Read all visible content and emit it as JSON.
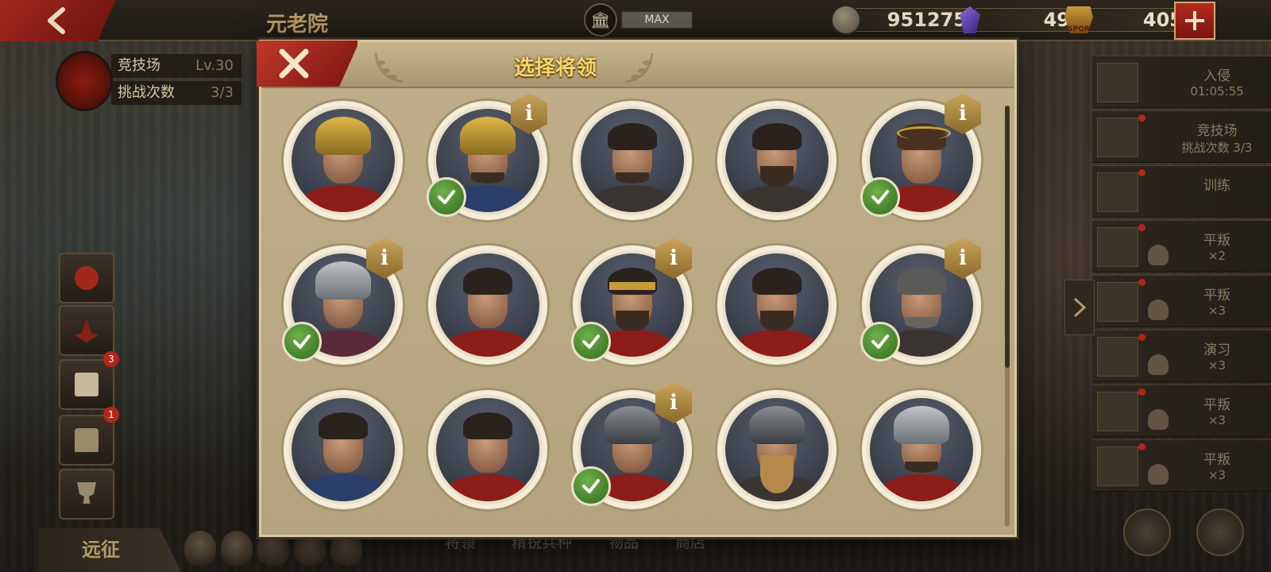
{
  "topbar": {
    "title": "元老院",
    "max_label": "MAX",
    "coins": "951275",
    "gems": "49",
    "spqr": "405",
    "spqr_icon_text": "SPQR"
  },
  "arena_card": {
    "name": "竞技场",
    "level": "Lv.30",
    "challenge_label": "挑战次数",
    "challenge_value": "3/3"
  },
  "side_badges": {
    "video": "3",
    "chest": "1"
  },
  "expedition": "远征",
  "bottom_nav": [
    "将领",
    "精锐兵种",
    "物品",
    "商店"
  ],
  "right_tasks": [
    {
      "line1": "入侵",
      "line2": "01:05:55"
    },
    {
      "line1": "竞技场",
      "line2": "挑战次数 3/3"
    },
    {
      "line1": "训练",
      "line2": ""
    },
    {
      "line1": "平叛",
      "line2": "×2"
    },
    {
      "line1": "平叛",
      "line2": "×3"
    },
    {
      "line1": "演习",
      "line2": "×3"
    },
    {
      "line1": "平叛",
      "line2": "×3"
    },
    {
      "line1": "平叛",
      "line2": "×3"
    }
  ],
  "modal": {
    "title": "选择将领",
    "generals": [
      {
        "look": "gold-helmet",
        "selected": false,
        "info": false
      },
      {
        "look": "bearded-helm",
        "selected": true,
        "info": true
      },
      {
        "look": "asian-bun",
        "selected": false,
        "info": false
      },
      {
        "look": "asian-bearded",
        "selected": false,
        "info": false
      },
      {
        "look": "laurel-crown",
        "selected": true,
        "info": true
      },
      {
        "look": "silver-helmet",
        "selected": true,
        "info": true
      },
      {
        "look": "short-hair",
        "selected": false,
        "info": false
      },
      {
        "look": "headband",
        "selected": true,
        "info": true
      },
      {
        "look": "roman-beard",
        "selected": false,
        "info": false
      },
      {
        "look": "grey-hair",
        "selected": true,
        "info": true
      },
      {
        "look": "blue-officer",
        "selected": false,
        "info": false
      },
      {
        "look": "red-cloak",
        "selected": false,
        "info": false
      },
      {
        "look": "dark-helmet",
        "selected": true,
        "info": true
      },
      {
        "look": "winged-helmet",
        "selected": false,
        "info": false
      },
      {
        "look": "gold-rim-helmet",
        "selected": false,
        "info": false
      }
    ]
  },
  "info_glyph": "i",
  "colors": {
    "accent_red": "#a3281c",
    "gold": "#f7d56a",
    "check_green": "#4f9a32"
  }
}
